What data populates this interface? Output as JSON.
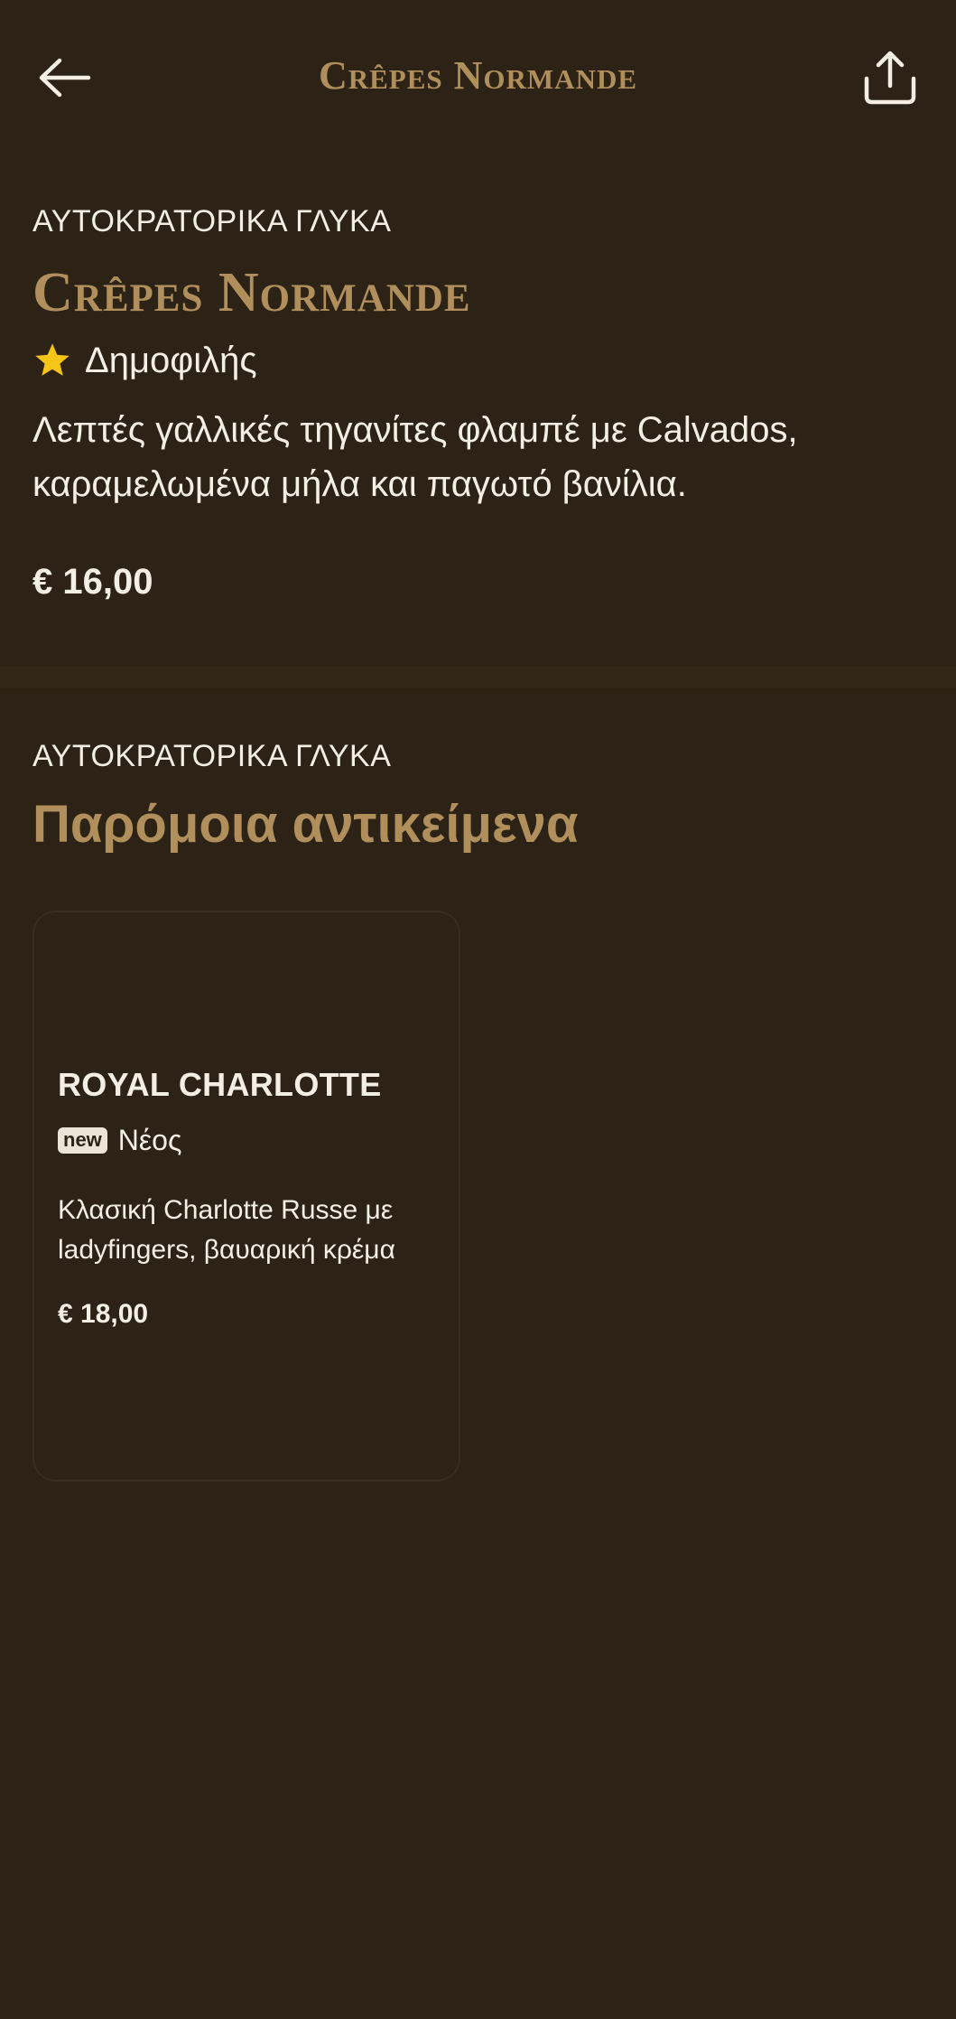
{
  "header": {
    "title": "Crêpes Normande",
    "back_icon": "arrow-left-icon",
    "share_icon": "share-icon"
  },
  "item": {
    "category": "ΑΥΤΟΚΡΑΤΟΡΙΚΑ ΓΛΥΚΑ",
    "name": "Crêpes Normande",
    "badge": {
      "icon": "star-icon",
      "label": "Δημοφιλής"
    },
    "description": "Λεπτές γαλλικές τηγανίτες φλαμπέ με Calvados, καραμελωμένα μήλα και παγωτό βανίλια.",
    "price": "€ 16,00"
  },
  "similar": {
    "category": "ΑΥΤΟΚΡΑΤΟΡΙΚΑ ΓΛΥΚΑ",
    "title": "Παρόμοια αντικείμενα",
    "items": [
      {
        "name": "ROYAL CHARLOTTE",
        "pill": "new",
        "badge_label": "Νέος",
        "description": "Κλασική Charlotte Russe με ladyfingers, βαυαρική κρέμα",
        "price": "€ 18,00"
      }
    ]
  },
  "colors": {
    "background": "#2c2316",
    "accent_gold": "#b08f5c",
    "text": "#f4efe5",
    "star": "#f5c518",
    "divider": "#322818"
  }
}
